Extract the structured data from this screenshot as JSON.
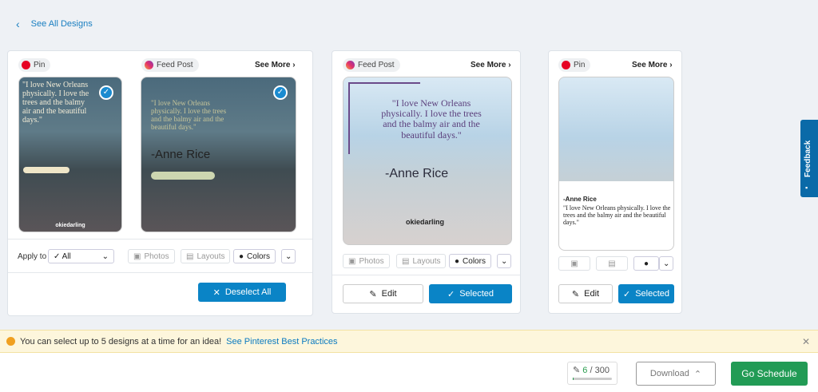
{
  "nav": {
    "back_label": "See All Designs"
  },
  "card1": {
    "chip1": "Pin",
    "chip2": "Feed Post",
    "see_more": "See More",
    "quote1": "\"I love New Orleans physically. I love the trees and the balmy air  and the beautiful days.\"",
    "quote2": "\"I love New Orleans physically. I love the trees and the balmy air  and the beautiful days.\"",
    "author": "-Anne Rice",
    "handle": "okiedarling",
    "apply_label": "Apply to",
    "apply_value": "All",
    "photos": "Photos",
    "layouts": "Layouts",
    "colors": "Colors",
    "deselect": "Deselect All"
  },
  "card2": {
    "chip": "Feed Post",
    "see_more": "See More",
    "quote": "\"I love New Orleans physically. I love the trees and the balmy air  and the beautiful days.\"",
    "author": "-Anne Rice",
    "handle": "okiedarling",
    "photos": "Photos",
    "layouts": "Layouts",
    "colors": "Colors",
    "edit": "Edit",
    "selected": "Selected"
  },
  "card3": {
    "chip": "Pin",
    "see_more": "See More",
    "author": "-Anne Rice",
    "quote": "\"I love New Orleans physically. I love the trees and the balmy air  and the beautiful days.\"",
    "edit": "Edit",
    "selected": "Selected"
  },
  "feedback": "Feedback",
  "banner": {
    "text": "You can select up to 5 designs at a time for an idea!",
    "link": "See Pinterest Best Practices"
  },
  "footer": {
    "used": "6",
    "total": "/ 300",
    "usage_fraction": 0.02,
    "download": "Download",
    "schedule": "Go Schedule"
  }
}
